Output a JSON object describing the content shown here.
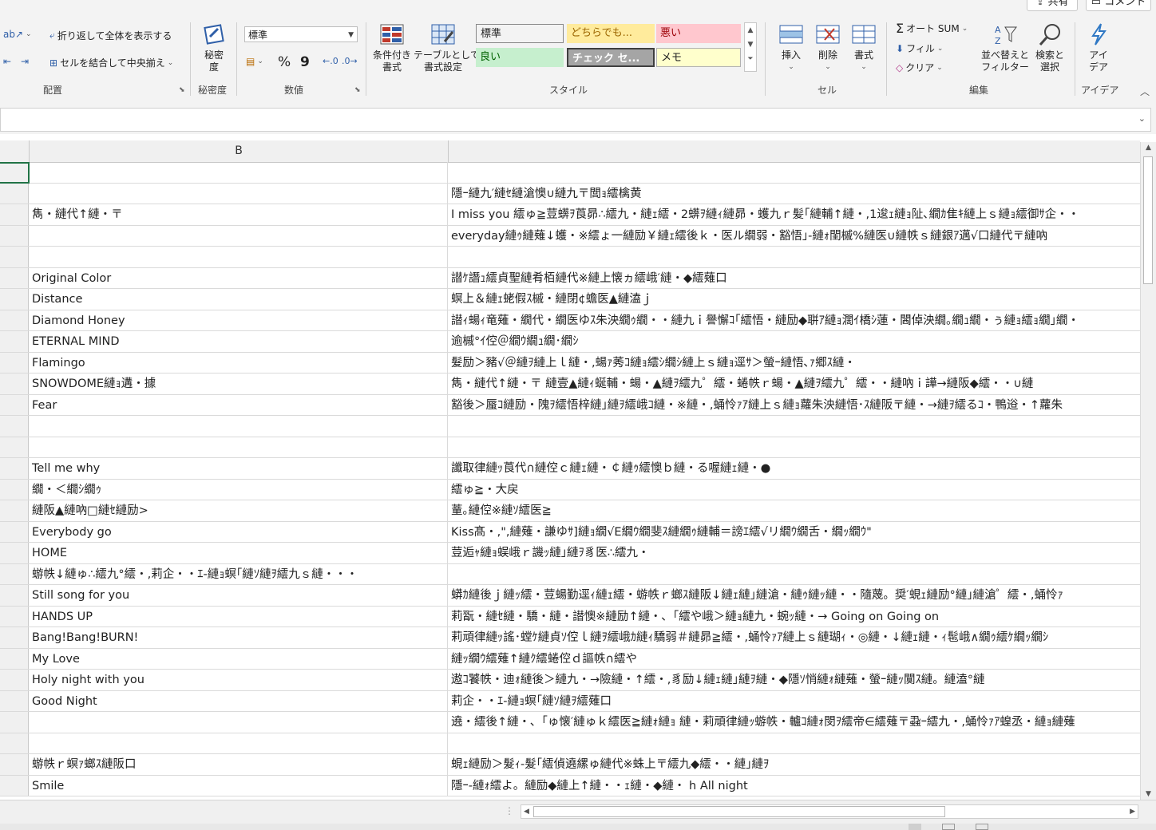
{
  "topbar": {
    "share": "共有",
    "comment": "コメント"
  },
  "ribbon": {
    "alignment": {
      "wrap_text": "折り返して全体を表示する",
      "merge_center": "セルを結合して中央揃え",
      "label": "配置"
    },
    "sensitivity": {
      "button": "秘密\n度",
      "label": "秘密度"
    },
    "number": {
      "format_value": "標準",
      "percent": "%",
      "comma": "9",
      "label": "数値"
    },
    "styles": {
      "conditional": "条件付き\n書式",
      "as_table": "テーブルとして\n書式設定",
      "cells": [
        {
          "text": "標準",
          "bg": "#ffffff",
          "color": "#222222"
        },
        {
          "text": "どちらでも...",
          "bg": "#ffeb9c",
          "color": "#9c6500"
        },
        {
          "text": "悪い",
          "bg": "#ffc7ce",
          "color": "#9c0006"
        },
        {
          "text": "良い",
          "bg": "#c6efce",
          "color": "#006100"
        },
        {
          "text": "チェック セ...",
          "bg": "#a5a5a5",
          "color": "#ffffff"
        },
        {
          "text": "メモ",
          "bg": "#ffffcc",
          "color": "#222222"
        }
      ],
      "label": "スタイル"
    },
    "cells_group": {
      "insert": "挿入",
      "delete": "削除",
      "format": "書式",
      "label": "セル"
    },
    "editing": {
      "autosum": "オート SUM",
      "fill": "フィル",
      "clear": "クリア",
      "sort_filter": "並べ替えと\nフィルター",
      "find_select": "検索と\n選択",
      "label": "編集"
    },
    "ideas": {
      "button": "アイ\nデア",
      "label": "アイデア"
    }
  },
  "sheet": {
    "columns": [
      "B"
    ],
    "rows": [
      {
        "b": "",
        "c": ""
      },
      {
        "b": "",
        "c": "隱ｰ縺九′縺ｾ縺滄懊∪縺九〒閭ｮ繧檎黄"
      },
      {
        "b": "雋・縺代↑縺・〒",
        "c": "I miss you 繧ゅ≧荳蠎ｦ莨昴∴繧九・縺ｪ繧・2蠎ｦ縺ｨ縺昴・蠖九ｒ髪｢縺輔↑縺・,1逡ｪ縺ｮ阯､繝ｶ隹ｷ縺上ｓ縺ｮ繧御ｻ企・・"
      },
      {
        "b": "",
        "c": "everyday縺ｩ縺薙↓蠖・※繧ょ一縺励￥縺ｪ繧後ｋ・医ル繝弱・豁悟｣-縺ｫ閨槭%縺医∪縺帙ｓ縺銀ｱ邁√口縺代〒縺吶"
      },
      {
        "b": "",
        "c": ""
      },
      {
        "b": "Original Color",
        "c": "譛ｹ譖ｭ繧貞聖縺肴栢縺代※縺上懐ヵ繧峨′縺・◆繧薙口"
      },
      {
        "b": "Distance",
        "c": "螟上＆縺ｪ蛯假ｽ槭・縺閉¢蟾医▲縺溘ｊ"
      },
      {
        "b": "Diamond Honey",
        "c": "譛ｨ蝪ｨ竜薙・繝代・繝医ゆｽ朱泱繝ｩ繝・・縺九ｉ譽懈ｺ｢繧悟・縺励◆聠ｱ縺ｮ濶ｲ橋ｼ蓮・閪倬泱繝｡繝ｭ繝・ぅ縺ｮ繧ｮ繝｣繝・"
      },
      {
        "b": "ETERNAL MIND",
        "c": "逾槭°ｲ倥＠繝ｳ繝ｭ繝･繝ｼ"
      },
      {
        "b": "Flamingo",
        "c": "髮励＞豬√＠縺ｦ縺上ｌ縺・,蝪ｧ莠ｺ縺ｮ繧ｼ繝ｼ縺上ｓ縺ｮ逕ｻ＞螢ｰ縺悟､ｧ郷ｽ縺・"
      },
      {
        "b": "SNOWDOME縺ｮ遘・據",
        "c": "雋・縺代↑縺・〒 縺壹▲縺ｨ蜒輔・蝪・▲縺ｦ繧九゜繧・蜷帙ｒ蝪・▲縺ｦ繧九゜繧・・縺吶ｉ譁→縺阪◆繧・・∪縺"
      },
      {
        "b": "Fear",
        "c": "豁後＞蜃ｺ縺励・隗ｦ繧悟梓縺｣縺ｦ繧峨ｺ縺・※縺・,蛹怜ｧｱ縺上ｓ縺ｮ蘿朱泱縺悟･ｽ縺阪〒縺・→縺ｦ繧るｺ・鴨逧・↑蘿朱"
      },
      {
        "b": "",
        "c": ""
      },
      {
        "b": "",
        "c": ""
      },
      {
        "b": "Tell me why",
        "c": "讖取律縺ｯ莨代∩縺倥ｃ縺ｪ縺・￠縺ｩ繧懊ｂ縺・る喔縺ｪ縺・●"
      },
      {
        "b": "繝・＜繝ｼ繝ｩ",
        "c": "繧ゅ≧・大戻"
      },
      {
        "b": "縺阪▲縺吶□縺ｾ縺励>",
        "c": "蕫｡縺倥※縺ｿ繧医≧"
      },
      {
        "b": "Everybody go",
        "c": "Kiss髙・,\",縺薙・謙ゆｻ]縺ｮ繝√Ε繝ｳ繝斐ｽ縺繝ｩ縺輔＝謗ｴ繧√リ繝ｳ繝舌・繝ｯ繝ｳ\""
      },
      {
        "b": "HOME",
        "c": "荳逅ｬ縺ｮ蜈峨ｒ譏ｯ縺｣縺ｦ豸医∴繧九・"
      },
      {
        "b": "蝣帙↓縺ゅ∴繧九°繧・,莉企・・ｴ-縺ｮ螟｢縺ｿ縺ｦ繧九ｓ縺・・・",
        "c": ""
      },
      {
        "b": "Still song for you",
        "c": "蟒ｶ縺後ｊ縺ｯ繧・荳蝪勤逕ｨ縺ｪ繧・蝣帙ｒ螂ｽ縺阪↓縺ｪ縺｣縺滄・縺ｩ縺ｯ縺・・隨蔑。奨′蜆ｪ縺励°縺｣縺滄゜繧・,蛹怜ｧ"
      },
      {
        "b": "HANDS UP",
        "c": "莉翫・縺ｾ縺・驕・縺・譛懊※縺励↑縺・､「繧や峨＞縺ｮ縺九・蜿ｯ縺・→ Going on Going on"
      },
      {
        "b": "Bang!Bang!BURN!",
        "c": "莉頑律縺ｯ謠･螳ｹ縺貞ｿ倥ｌ縺ｦ繧峨ｶ縺ｨ驕弱＃縺昴≧繧・,蛹怜ｧｱ縺上ｓ縺瑚ｨ・◎縺・↓縺ｪ縺・ｨ髢峨∧繝ｩ繧ｹ繝ｯ繝ｼ"
      },
      {
        "b": "My Love",
        "c": "縺ｯ繝ｳ繧薙↑縺ｸ繧蜷倥ｄ謳帙∩繧や"
      },
      {
        "b": "Holy night with you",
        "c": "遨ｺ饕帙・迪ｫ縺後＞縺九・→險縺・↑繧・,豸励↓縺ｪ縺｣縺ｦ縺・◆隱ｿ悄縺ｫ縺薙・螢ｰ縺ｯ闃ｽ縺。縺溘°縺"
      },
      {
        "b": "Good Night",
        "c": "莉企・・ｴ-縺ｮ螟｢縺ｿ縺ｦ繧薙口"
      },
      {
        "b": "",
        "c": "遶・繧後↑縺・､「ゅ懐′縺ゅｋ繧医≧縺ｫ縺ｮ 縺・莉頑律縺ｯ蝣帙・轤ｺ縺ｫ閔ｦ繧帝∈繧薙〒蝨ｰ繧九・,蛹怜ｧｱ蝗丞・縺ｮ縺薙"
      },
      {
        "b": "",
        "c": ""
      },
      {
        "b": "蝣帙ｒ螟ｧ螂ｽ縺阪口",
        "c": "蜆ｪ縺励＞髮ｨ-髮｢繧偵遶縲ゅ縺代※蛛上〒繧九◆繧・・縺｣縺ｦ"
      },
      {
        "b": "Smile",
        "c": "隱ｰ-縺ｫ繧よ。縺励◆縺上↑縺・・ｪ縺・◆縺・ h All night"
      }
    ]
  },
  "colors": {
    "accent": "#217346",
    "grid": "#dadada",
    "ribbon_bg": "#f3f3f3"
  }
}
